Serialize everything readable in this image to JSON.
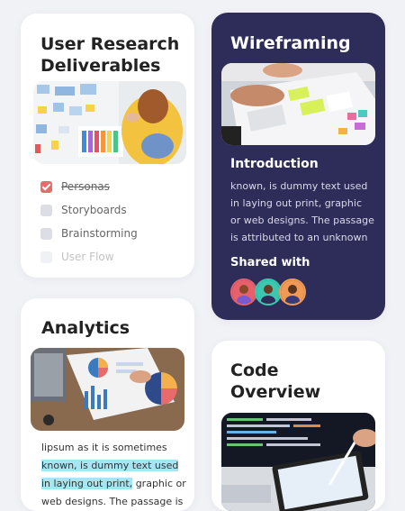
{
  "research": {
    "title_line1": "User Research",
    "title_line2": "Deliverables",
    "checklist": [
      {
        "label": "Personas",
        "checked": true
      },
      {
        "label": "Storyboards",
        "checked": false
      },
      {
        "label": "Brainstorming",
        "checked": false
      },
      {
        "label": "User Flow",
        "checked": false
      }
    ]
  },
  "wireframing": {
    "title": "Wireframing",
    "intro_heading": "Introduction",
    "intro_text": "known, is dummy text used in laying out print, graphic or web designs. The passage is attributed to an unknown",
    "shared_label": "Shared with",
    "avatar_colors": [
      "#e8606c",
      "#3cc8b0",
      "#f09a55"
    ]
  },
  "analytics": {
    "title": "Analytics",
    "text_line1": "lipsum as it is sometimes",
    "text_highlight_a": "known, is dummy text used",
    "text_highlight_b": "in laying out print,",
    "text_line3_rest": " graphic or",
    "text_line4": "web designs. The passage is"
  },
  "code": {
    "title_line1": "Code",
    "title_line2": "Overview"
  },
  "colors": {
    "dark_card": "#2e2d5a",
    "check_accent": "#e86b6b",
    "highlight": "#a6e6f4"
  }
}
